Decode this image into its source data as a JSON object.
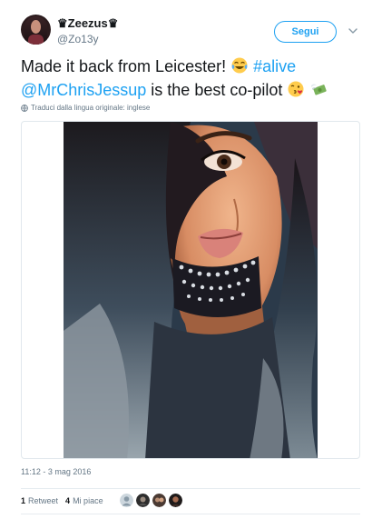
{
  "author": {
    "display_name": "♛Zeezus♛",
    "handle": "@Zo13y"
  },
  "follow_button": {
    "label": "Segui"
  },
  "tweet": {
    "line1_text": "Made it back from Leicester! ",
    "hashtag": "#alive",
    "mention": "@MrChrisJessup",
    "line2_text": " is the best co-pilot "
  },
  "translation_note": "Traduci dalla lingua originale: inglese",
  "timestamp": "11:12 - 3 mag 2016",
  "stats": {
    "retweets_count": "1",
    "retweets_label": "Retweet",
    "likes_count": "4",
    "likes_label": "Mi piace"
  },
  "icons": {
    "caret": "chevron-down-icon",
    "globe": "globe-icon"
  },
  "colors": {
    "accent": "#1da1f2",
    "muted": "#657786",
    "text": "#14171a"
  }
}
